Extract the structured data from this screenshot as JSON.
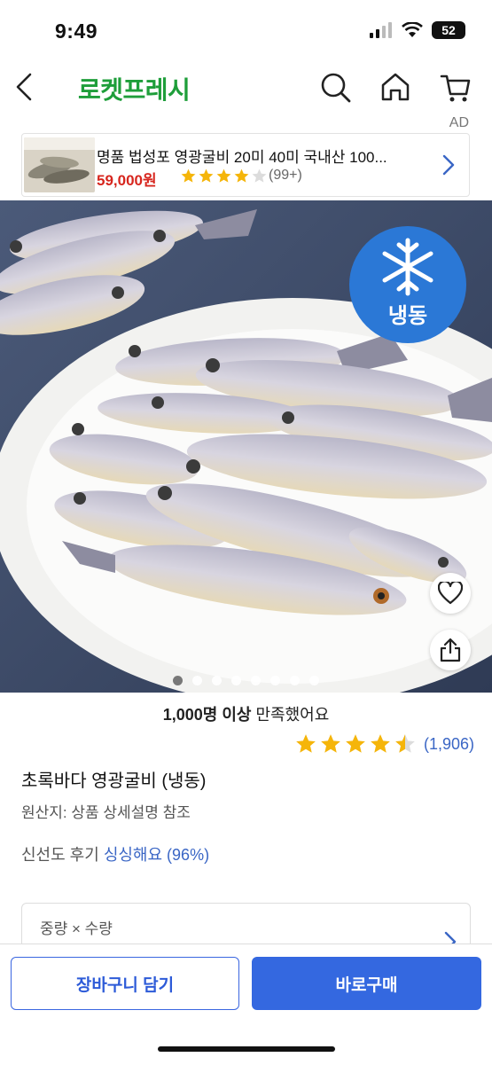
{
  "status": {
    "time": "9:49",
    "battery": "52"
  },
  "nav": {
    "brand": "로켓프레시"
  },
  "ad_label": "AD",
  "ad": {
    "title": "명품 법성포 영광굴비 20미 40미 국내산 100...",
    "price": "59,000원",
    "reviews": "(99+)",
    "rating": 4
  },
  "hero": {
    "badge": "냉동",
    "slides_total": 8,
    "active_slide": 1
  },
  "info": {
    "satisfied_bold": "1,000명 이상",
    "satisfied_rest": " 만족했어요",
    "rating": 4.5,
    "rating_count": "(1,906)",
    "product_name": "초록바다 영광굴비 (냉동)",
    "origin": "원산지: 상품 상세설명 참조",
    "fresh_label": "신선도 후기 ",
    "fresh_value": "싱싱해요 (96%)",
    "option_label": "중량 × 수량"
  },
  "buttons": {
    "cart": "장바구니 담기",
    "buy": "바로구매"
  },
  "colors": {
    "brand": "#1e9e3a",
    "accent": "#3468e0",
    "price": "#d7261e",
    "star": "#f5b50a"
  }
}
